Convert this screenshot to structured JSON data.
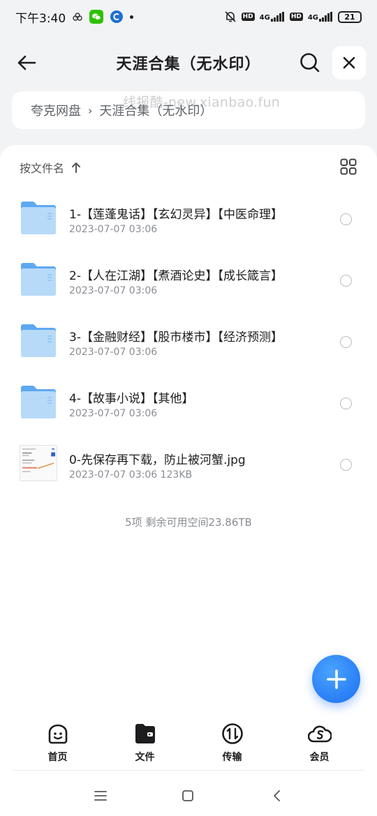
{
  "status_bar": {
    "time": "下午3:40",
    "net1": "4G",
    "net2": "4G",
    "hd": "HD",
    "battery": "21"
  },
  "header": {
    "title": "天涯合集（无水印）"
  },
  "breadcrumb": {
    "root": "夸克网盘",
    "current": "天涯合集（无水印）",
    "separator": "›"
  },
  "watermark": "线报酷-new.xianbao.fun",
  "sort": {
    "label": "按文件名"
  },
  "files": [
    {
      "name": "1-【莲蓬鬼话】【玄幻灵异】【中医命理】",
      "meta": "2023-07-07 03:06",
      "type": "folder"
    },
    {
      "name": "2-【人在江湖】【煮酒论史】【成长箴言】",
      "meta": "2023-07-07 03:06",
      "type": "folder"
    },
    {
      "name": "3-【金融财经】【股市楼市】【经济预测】",
      "meta": "2023-07-07 03:06",
      "type": "folder"
    },
    {
      "name": "4-【故事小说】【其他】",
      "meta": "2023-07-07 03:06",
      "type": "folder"
    },
    {
      "name": "0-先保存再下载，防止被河蟹.jpg",
      "meta": "2023-07-07 03:06   123KB",
      "type": "image"
    }
  ],
  "summary": "5项 剩余可用空间23.86TB",
  "nav": {
    "home": "首页",
    "files": "文件",
    "transfer": "传输",
    "member": "会员"
  },
  "colors": {
    "accent": "#1c6ff0",
    "folder": "#5ea8f2",
    "background": "#f2f3f5"
  }
}
